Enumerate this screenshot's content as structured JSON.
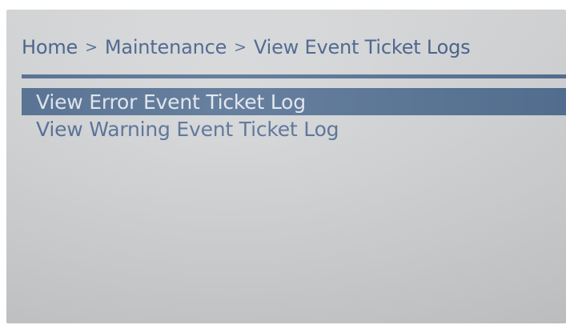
{
  "breadcrumb": {
    "items": [
      "Home",
      "Maintenance",
      "View Event Ticket Logs"
    ],
    "separator": ">"
  },
  "menu": {
    "items": [
      {
        "label": "View Error Event Ticket Log",
        "selected": true
      },
      {
        "label": "View Warning Event Ticket Log",
        "selected": false
      }
    ]
  },
  "colors": {
    "accent": "#4d6a8e",
    "text": "#4a6690",
    "screen_background": "#cfd1d3",
    "selected_text": "#dfe5ee"
  }
}
